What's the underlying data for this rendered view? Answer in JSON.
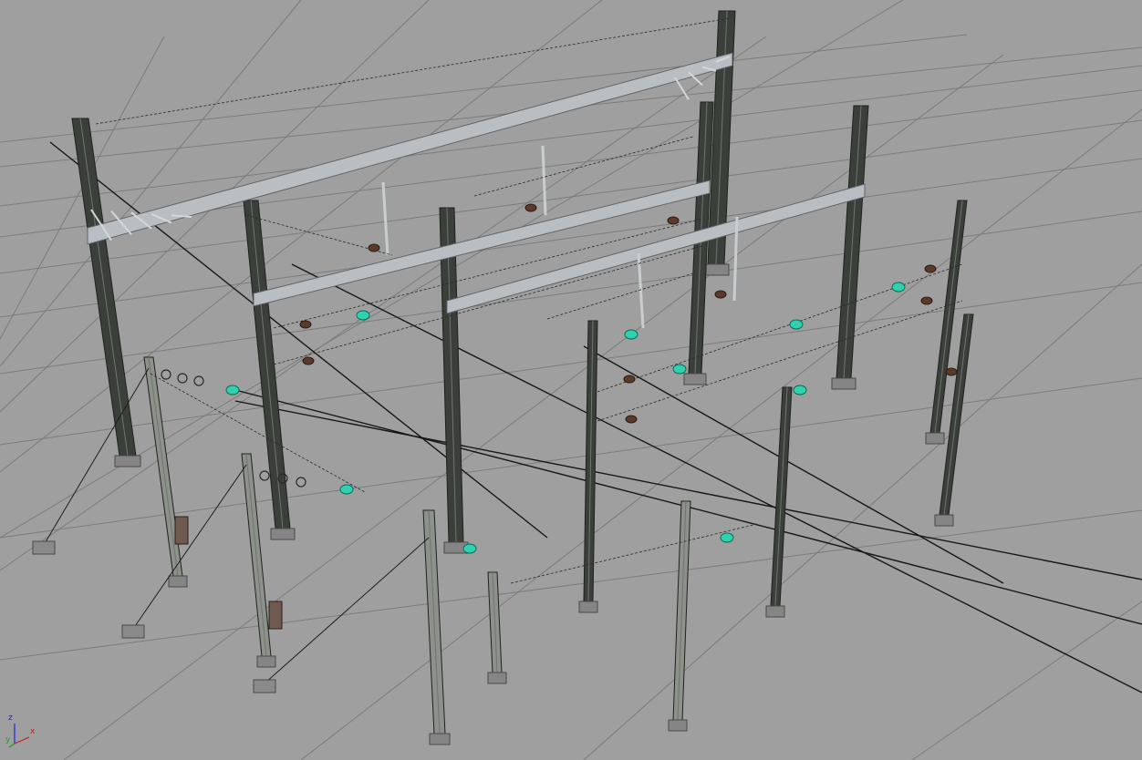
{
  "viewport": {
    "background": "#9f9f9f",
    "grid_color": "#7c7c7c",
    "wire_color": "#161616",
    "steel_color": "#b8bec2",
    "mast_color": "#3a3f3a",
    "insulator_color": "#2fd1b1"
  },
  "axis_gizmo": {
    "x_label": "x",
    "y_label": "y",
    "z_label": "z",
    "x_color": "#d01a1a",
    "y_color": "#19a319",
    "z_color": "#2323d6"
  }
}
